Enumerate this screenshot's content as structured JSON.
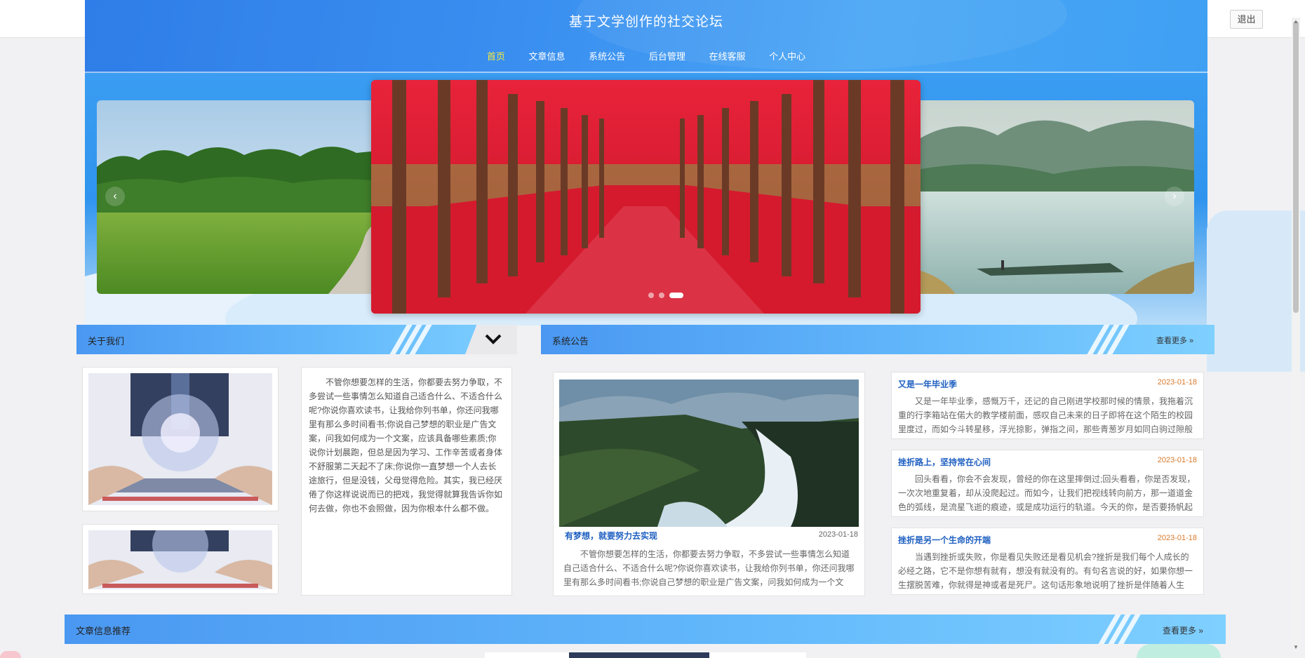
{
  "header": {
    "title": "基于文学创作的社交论坛",
    "logout": "退出",
    "nav": [
      "首页",
      "文章信息",
      "系统公告",
      "后台管理",
      "在线客服",
      "个人中心"
    ]
  },
  "banner": {
    "prev": "‹",
    "next": "›",
    "dots": 3,
    "active_dot": 2
  },
  "about": {
    "title": "关于我们",
    "chevron_icon": "chevron-down-icon",
    "text": "不管你想要怎样的生活，你都要去努力争取，不多尝试一些事情怎么知道自己适合什么、不适合什么呢?你说你喜欢读书，让我给你列书单，你还问我哪里有那么多时间看书;你说自己梦想的职业是广告文案，问我如何成为一个文案，应该具备哪些素质;你说你计划晨跑，但总是因为学习、工作辛苦或者身体不舒服第二天起不了床;你说你一直梦想一个人去长途旅行，但是没钱，父母觉得危险。其实，我已经厌倦了你这样说说而已的把戏，我觉得就算我告诉你如何去做，你也不会照做，因为你根本什么都不做。"
  },
  "notice": {
    "title": "系统公告",
    "more": "查看更多",
    "main": {
      "title": "有梦想，就要努力去实现",
      "date": "2023-01-18",
      "body": "不管你想要怎样的生活，你都要去努力争取，不多尝试一些事情怎么知道自己适合什么、不适合什么呢?你说你喜欢读书，让我给你列书单，你还问我哪里有那么多时间看书;你说自己梦想的职业是广告文案，问我如何成为一个文案，"
    },
    "items": [
      {
        "title": "又是一年毕业季",
        "date": "2023-01-18",
        "body": "又是一年毕业季，感慨万千，还记的自己刚进学校那时候的情景，我拖着沉重的行李箱站在偌大的教学楼前面，感叹自己未来的日子即将在这个陌生的校园里度过，而如今斗转星移，浮光掠影，弹指之间，那些青葱岁月如同白驹过隙般悄然从"
      },
      {
        "title": "挫折路上，坚持常在心间",
        "date": "2023-01-18",
        "body": "回头看看，你会不会发现，曾经的你在这里摔倒过;回头看看，你是否发现，一次次地重复着，却从没爬起过。而如今，让我们把视线转向前方，那一道道金色的弧线，是流星飞逝的痕迹，或是成功运行的轨道。今天的你，是否要扬帆起航，让"
      },
      {
        "title": "挫折是另一个生命的开端",
        "date": "2023-01-18",
        "body": "当遇到挫折或失败，你是看见失败还是看见机会?挫折是我们每个人成长的必经之路，它不是你想有就有，想没有就没有的。有句名言说的好，如果你想一生摆脱苦难，你就得是神或者是死尸。这句话形象地说明了挫折是伴随着人生的，是谁都"
      }
    ]
  },
  "recommend": {
    "title": "文章信息推荐",
    "more": "查看更多"
  },
  "colors": {
    "header_blue": "#2f7de8",
    "accent_yellow": "#f5e93a",
    "title_blue": "#1e5fc1",
    "date_orange": "#d77a2c"
  }
}
